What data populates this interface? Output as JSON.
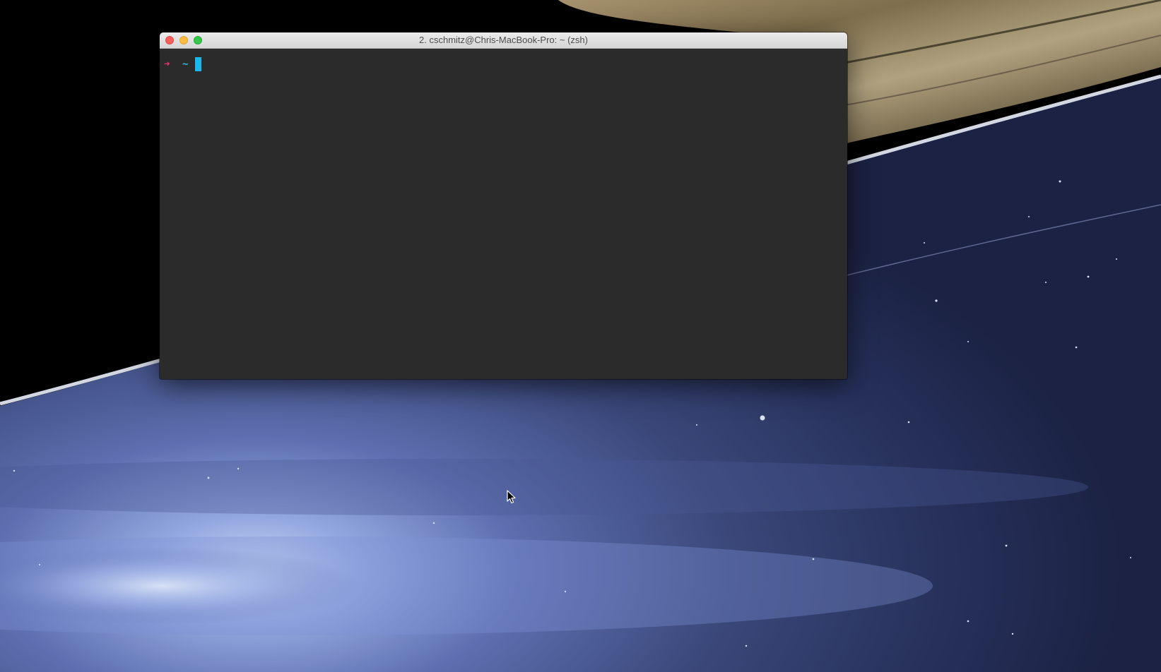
{
  "window": {
    "title": "2. cschmitz@Chris-MacBook-Pro: ~ (zsh)"
  },
  "terminal": {
    "prompt_symbol": "➜",
    "directory": "~",
    "cursor_color": "#19b9ed",
    "prompt_color": "#fc2e74",
    "directory_color": "#27c1d9",
    "background_color": "#2b2b2b"
  },
  "icons": {
    "close": "close-icon",
    "minimize": "minimize-icon",
    "zoom": "zoom-icon",
    "pointer": "mouse-pointer-icon"
  }
}
